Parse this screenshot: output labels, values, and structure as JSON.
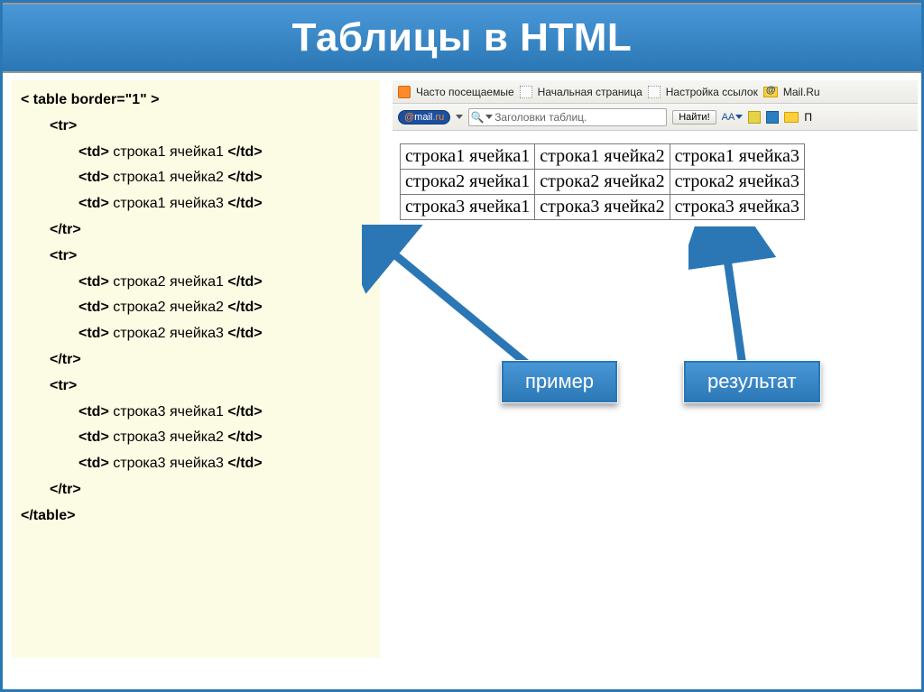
{
  "title": "Таблицы в HTML",
  "code": {
    "table_open": "< table border=\"1\" >",
    "tr_open": "<tr>",
    "tr_close": "</tr>",
    "td_open": "<td>",
    "td_close": "</td>",
    "table_close": "</table>",
    "rows": [
      [
        "строка1 ячейка1",
        "строка1 ячейка2",
        "строка1 ячейка3"
      ],
      [
        "строка2 ячейка1",
        "строка2 ячейка2",
        "строка2 ячейка3"
      ],
      [
        "строка3 ячейка1",
        "строка3 ячейка2",
        "строка3 ячейка3"
      ]
    ]
  },
  "browser": {
    "bookmarks": {
      "frequent": "Часто посещаемые",
      "start": "Начальная страница",
      "links": "Настройка ссылок",
      "mailru": "Mail.Ru"
    },
    "brand": "@mail.ru",
    "search_value": "Заголовки таблиц.",
    "find": "Найти!",
    "aa": "АА",
    "p_label": "П"
  },
  "result_table": [
    [
      "строка1 ячейка1",
      "строка1 ячейка2",
      "строка1 ячейка3"
    ],
    [
      "строка2 ячейка1",
      "строка2 ячейка2",
      "строка2 ячейка3"
    ],
    [
      "строка3 ячейка1",
      "строка3 ячейка2",
      "строка3 ячейка3"
    ]
  ],
  "labels": {
    "example": "пример",
    "result": "результат"
  }
}
